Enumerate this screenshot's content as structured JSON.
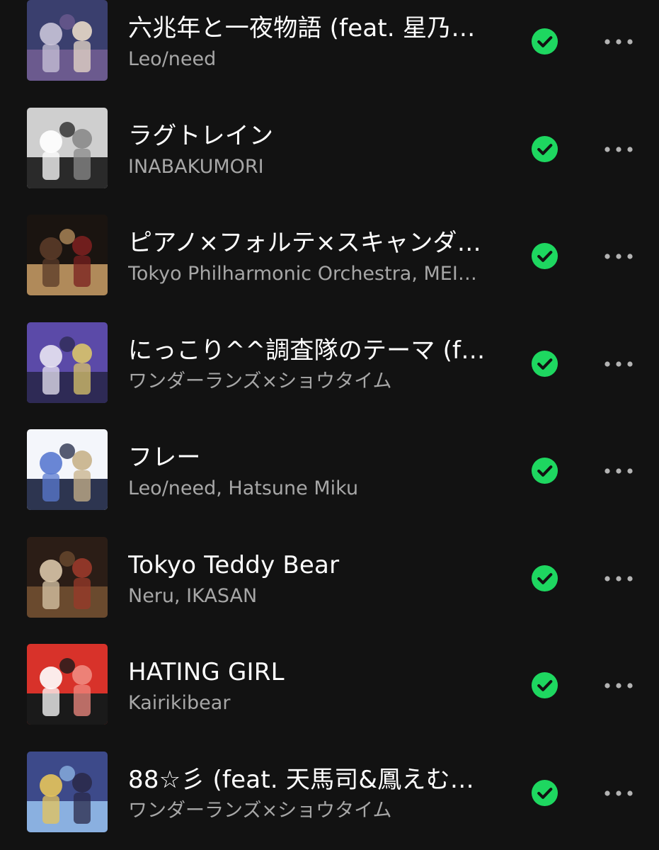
{
  "tracks": [
    {
      "title": "六兆年と一夜物語 (feat. 星乃…",
      "artist": "Leo/need",
      "art_colors": [
        "#3a3f6e",
        "#c9c4d8",
        "#6b5a8e",
        "#e8d9c8"
      ],
      "art_icon": "album-art-image",
      "downloaded": true
    },
    {
      "title": "ラグトレイン",
      "artist": "INABAKUMORI",
      "art_colors": [
        "#cfcfcf",
        "#ffffff",
        "#2a2a2a",
        "#8a8a8a"
      ],
      "art_icon": "album-art-image",
      "downloaded": true
    },
    {
      "title": "ピアノ×フォルテ×スキャンダ…",
      "artist": "Tokyo Philharmonic Orchestra, MEI…",
      "art_colors": [
        "#1a1410",
        "#5a3a28",
        "#b08a5a",
        "#7a1f1f"
      ],
      "art_icon": "album-art-image",
      "downloaded": true
    },
    {
      "title": "にっこり^^調査隊のテーマ (f…",
      "artist": "ワンダーランズ×ショウタイム",
      "art_colors": [
        "#5b4aa8",
        "#e8e4f2",
        "#2e2a55",
        "#d9c46a"
      ],
      "art_icon": "album-art-image",
      "downloaded": true
    },
    {
      "title": "フレー",
      "artist": "Leo/need, Hatsune Miku",
      "art_colors": [
        "#f4f6fb",
        "#5a7ad0",
        "#2d3550",
        "#c8b28a"
      ],
      "art_icon": "album-art-image",
      "downloaded": true
    },
    {
      "title": "Tokyo Teddy Bear",
      "artist": "Neru, IKASAN",
      "art_colors": [
        "#2b1d16",
        "#d9c7a8",
        "#6a4a2e",
        "#9a3a2a"
      ],
      "art_icon": "album-art-image",
      "downloaded": true
    },
    {
      "title": "HATING GIRL",
      "artist": "Kairikibear",
      "art_colors": [
        "#d8322a",
        "#ffffff",
        "#1a1a1a",
        "#f08a80"
      ],
      "art_icon": "album-art-image",
      "downloaded": true
    },
    {
      "title": "88☆彡 (feat. 天馬司&鳳えむ…",
      "artist": "ワンダーランズ×ショウタイム",
      "art_colors": [
        "#3d4a8a",
        "#e6c45a",
        "#8ab0e0",
        "#2a2a4a"
      ],
      "art_icon": "album-art-image",
      "downloaded": true
    }
  ],
  "colors": {
    "background": "#121212",
    "title": "#ffffff",
    "subtitle": "#a7a7a7",
    "downloaded_accent": "#1ed760",
    "more_dots": "#b3b3b3"
  },
  "icons": {
    "downloaded": "check-circle-icon",
    "more": "more-options-icon"
  }
}
